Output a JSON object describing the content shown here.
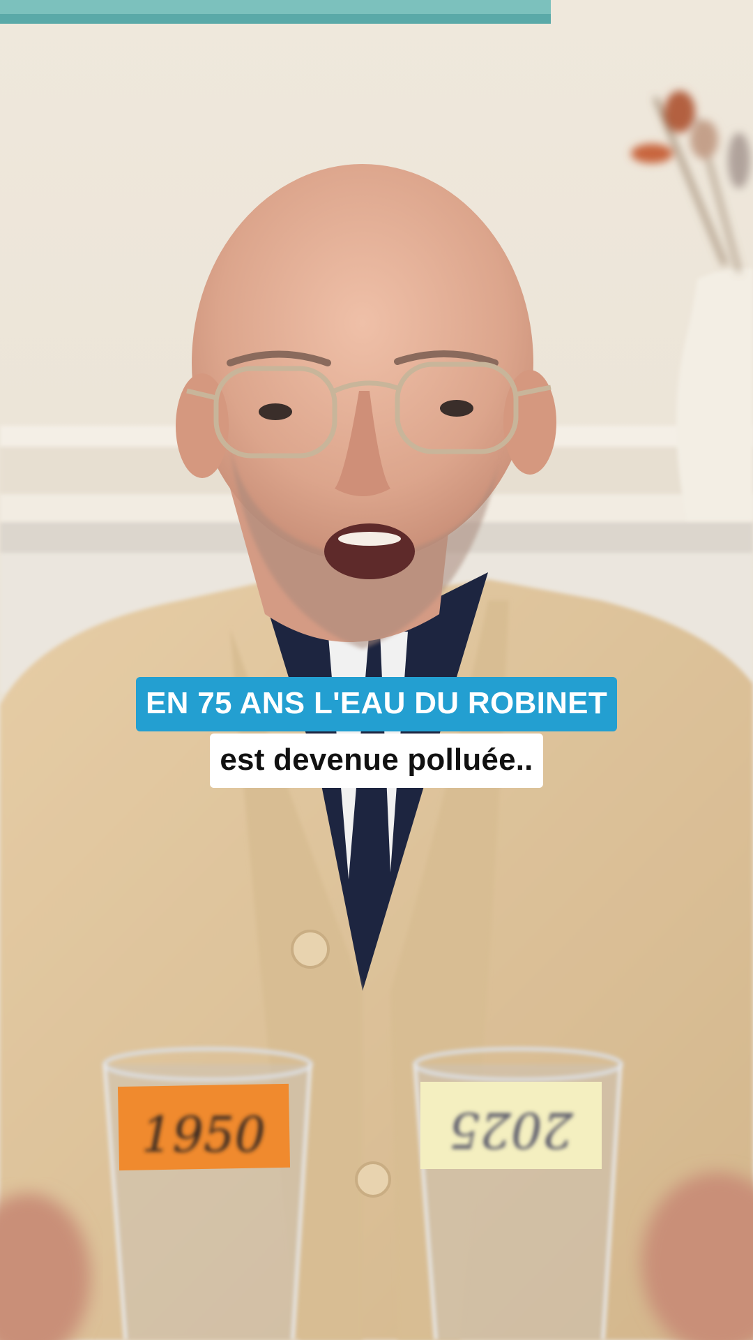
{
  "caption": {
    "line1": "EN 75 ANS L'EAU DU ROBINET",
    "line2": "est devenue polluée.."
  },
  "glasses": {
    "left_label": "1950",
    "right_label": "2025"
  },
  "colors": {
    "caption_blue": "#239fd1",
    "caption_white": "#ffffff",
    "wall": "#ede5d8",
    "cardigan": "#dec39b",
    "label_orange": "#f08a2e",
    "label_yellow": "#f4efc0"
  }
}
